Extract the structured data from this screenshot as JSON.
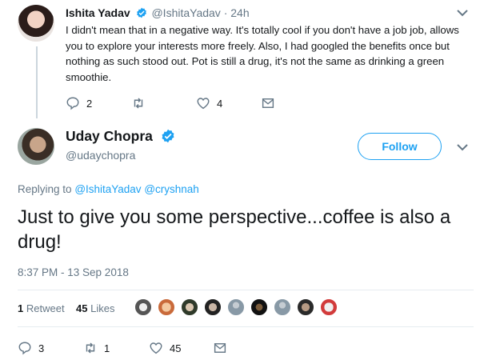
{
  "reply_tweet": {
    "author_name": "Ishita Yadav",
    "handle": "@IshitaYadav",
    "separator": "·",
    "time": "24h",
    "text": "I didn't mean that in a negative way. It's totally cool if you don't have a job job, allows you to explore your interests more freely. Also, I had googled the benefits once but nothing as such stood out. Pot is still a drug, it's not the same as drinking a green smoothie.",
    "reply_count": "2",
    "retweet_count": "",
    "like_count": "4"
  },
  "main_tweet": {
    "author_name": "Uday Chopra",
    "handle": "@udaychopra",
    "follow_label": "Follow",
    "replying_prefix": "Replying to",
    "replying_to": [
      "@IshitaYadav",
      "@cryshnah"
    ],
    "text": "Just to give you some perspective...coffee is also a drug!",
    "timestamp": "8:37 PM - 13 Sep 2018",
    "retweets_number": "1",
    "retweets_label": "Retweet",
    "likes_number": "45",
    "likes_label": "Likes",
    "reply_count": "3",
    "retweet_count": "1",
    "like_count": "45"
  },
  "icons": {
    "verified": "verified-badge-icon",
    "chevron": "chevron-down-icon",
    "reply": "reply-icon",
    "retweet": "retweet-icon",
    "like": "heart-icon",
    "dm": "envelope-icon"
  },
  "colors": {
    "accent": "#1da1f2",
    "muted": "#657786",
    "text": "#14171a",
    "thread_line": "#ccd6dd"
  }
}
